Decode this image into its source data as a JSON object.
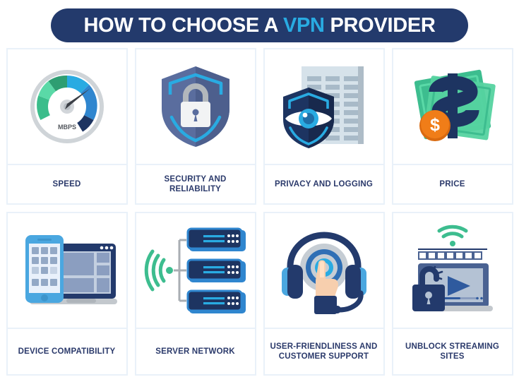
{
  "header": {
    "title_part1": "HOW TO CHOOSE A ",
    "title_highlight": "VPN",
    "title_part2": " PROVIDER",
    "banner_color": "#233a6c",
    "highlight_color": "#29abe2"
  },
  "theme": {
    "page_background": "#ffffff",
    "card_border": "#e9f1f9",
    "label_color": "#2b3a6b",
    "navy": "#233a6c",
    "blue": "#2f6fb5",
    "light_blue": "#29abe2",
    "green": "#3cc98a",
    "orange": "#f07d18",
    "gray": "#b9c5d1"
  },
  "cards": [
    {
      "id": "speed",
      "label": "SPEED",
      "icon": "speedometer-icon",
      "gauge_unit": "MBPS"
    },
    {
      "id": "security",
      "label": "SECURITY AND RELIABILITY",
      "icon": "shield-lock-icon"
    },
    {
      "id": "privacy",
      "label": "PRIVACY AND LOGGING",
      "icon": "shield-eye-document-icon"
    },
    {
      "id": "price",
      "label": "PRICE",
      "icon": "money-dollar-icon"
    },
    {
      "id": "device",
      "label": "DEVICE COMPATIBILITY",
      "icon": "laptop-phone-icon"
    },
    {
      "id": "server",
      "label": "SERVER NETWORK",
      "icon": "server-rack-wifi-icon"
    },
    {
      "id": "support",
      "label": "USER-FRIENDLINESS AND CUSTOMER SUPPORT",
      "icon": "headset-hand-icon"
    },
    {
      "id": "unblock",
      "label": "UNBLOCK STREAMING SITES",
      "icon": "laptop-play-unlock-icon"
    }
  ]
}
